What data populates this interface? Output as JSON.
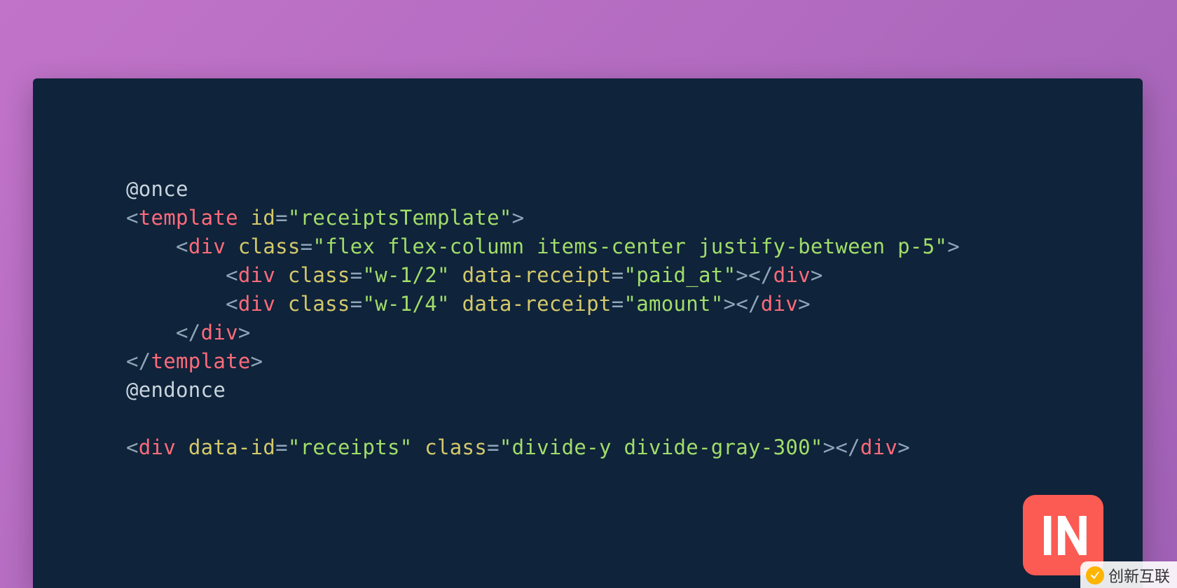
{
  "code": {
    "l1_dir": "@once",
    "l2_tag": "template",
    "l2_attr": "id",
    "l2_val": "receiptsTemplate",
    "l3_tag": "div",
    "l3_attr": "class",
    "l3_val": "flex flex-column items-center justify-between p-5",
    "l4_tag": "div",
    "l4_attr1": "class",
    "l4_val1": "w-1/2",
    "l4_attr2": "data-receipt",
    "l4_val2": "paid_at",
    "l5_tag": "div",
    "l5_attr1": "class",
    "l5_val1": "w-1/4",
    "l5_attr2": "data-receipt",
    "l5_val2": "amount",
    "l6_tag": "div",
    "l7_tag": "template",
    "l8_dir": "@endonce",
    "l10_tag": "div",
    "l10_attr1": "data-id",
    "l10_val1": "receipts",
    "l10_attr2": "class",
    "l10_val2": "divide-y divide-gray-300"
  },
  "watermark": {
    "text": "创新互联"
  }
}
